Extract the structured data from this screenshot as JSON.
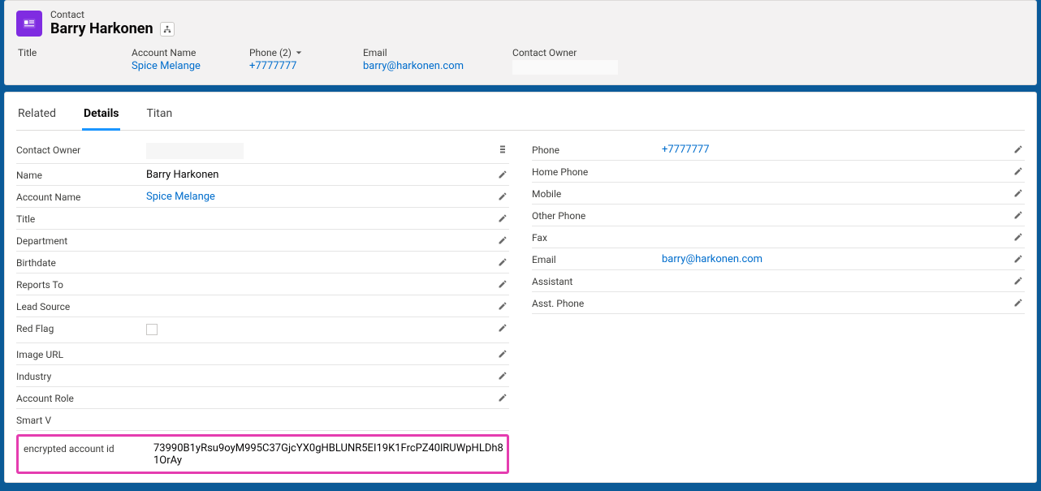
{
  "header": {
    "object_label": "Contact",
    "name": "Barry Harkonen"
  },
  "highlights": {
    "title_label": "Title",
    "title_value": "",
    "account_label": "Account Name",
    "account_value": "Spice Melange",
    "phone_label": "Phone (2)",
    "phone_value": "+7777777",
    "email_label": "Email",
    "email_value": "barry@harkonen.com",
    "owner_label": "Contact Owner"
  },
  "tabs": {
    "related": "Related",
    "details": "Details",
    "titan": "Titan"
  },
  "left_fields": [
    {
      "label": "Contact Owner",
      "value": "",
      "type": "blank",
      "icon": "stack"
    },
    {
      "label": "Name",
      "value": "Barry Harkonen",
      "type": "text",
      "icon": "edit"
    },
    {
      "label": "Account Name",
      "value": "Spice Melange",
      "type": "link",
      "icon": "edit"
    },
    {
      "label": "Title",
      "value": "",
      "type": "text",
      "icon": "edit"
    },
    {
      "label": "Department",
      "value": "",
      "type": "text",
      "icon": "edit"
    },
    {
      "label": "Birthdate",
      "value": "",
      "type": "text",
      "icon": "edit"
    },
    {
      "label": "Reports To",
      "value": "",
      "type": "text",
      "icon": "edit"
    },
    {
      "label": "Lead Source",
      "value": "",
      "type": "text",
      "icon": "edit"
    },
    {
      "label": "Red Flag",
      "value": "",
      "type": "checkbox",
      "icon": "edit"
    },
    {
      "label": "Image URL",
      "value": "",
      "type": "text",
      "icon": "edit"
    },
    {
      "label": "Industry",
      "value": "",
      "type": "text",
      "icon": "edit"
    },
    {
      "label": "Account Role",
      "value": "",
      "type": "text",
      "icon": "edit"
    },
    {
      "label": "Smart V",
      "value": "",
      "type": "text",
      "icon": "none"
    }
  ],
  "highlighted_field": {
    "label": "encrypted account id",
    "value": "73990B1yRsu9oyM995C37GjcYX0gHBLUNR5EI19K1FrcPZ40lRUWpHLDh81OrAy"
  },
  "right_fields": [
    {
      "label": "Phone",
      "value": "+7777777",
      "type": "link",
      "icon": "edit"
    },
    {
      "label": "Home Phone",
      "value": "",
      "type": "text",
      "icon": "edit"
    },
    {
      "label": "Mobile",
      "value": "",
      "type": "text",
      "icon": "edit"
    },
    {
      "label": "Other Phone",
      "value": "",
      "type": "text",
      "icon": "edit"
    },
    {
      "label": "Fax",
      "value": "",
      "type": "text",
      "icon": "edit"
    },
    {
      "label": "Email",
      "value": "barry@harkonen.com",
      "type": "link",
      "icon": "edit"
    },
    {
      "label": "Assistant",
      "value": "",
      "type": "text",
      "icon": "edit"
    },
    {
      "label": "Asst. Phone",
      "value": "",
      "type": "text",
      "icon": "edit"
    }
  ]
}
